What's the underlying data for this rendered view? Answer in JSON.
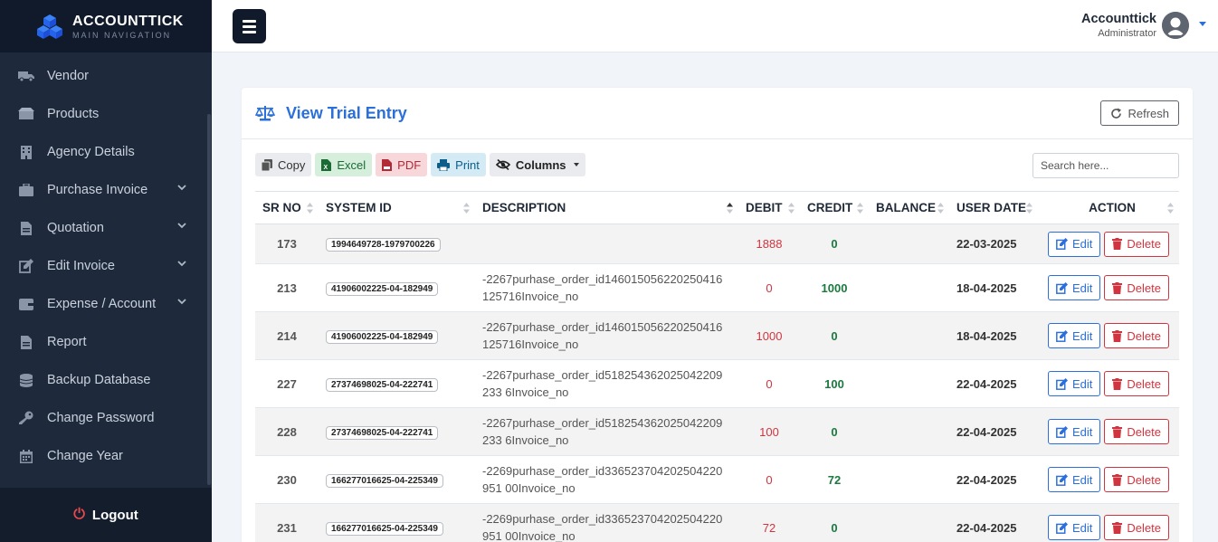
{
  "brand": {
    "title": "ACCOUNTTICK",
    "subtitle": "MAIN NAVIGATION"
  },
  "sidebar": {
    "items": [
      {
        "label": "Vendor",
        "icon": "truck-icon"
      },
      {
        "label": "Products",
        "icon": "box-icon"
      },
      {
        "label": "Agency Details",
        "icon": "building-icon"
      },
      {
        "label": "Purchase Invoice",
        "icon": "briefcase-icon",
        "expandable": true
      },
      {
        "label": "Quotation",
        "icon": "file-icon",
        "expandable": true
      },
      {
        "label": "Edit Invoice",
        "icon": "edit-icon",
        "expandable": true
      },
      {
        "label": "Expense / Account",
        "icon": "wallet-icon",
        "expandable": true
      },
      {
        "label": "Report",
        "icon": "file-icon"
      },
      {
        "label": "Backup Database",
        "icon": "database-icon"
      },
      {
        "label": "Change Password",
        "icon": "key-icon"
      },
      {
        "label": "Change Year",
        "icon": "calendar-icon"
      }
    ],
    "logout_label": "Logout"
  },
  "user": {
    "name": "Accounttick",
    "role": "Administrator"
  },
  "page": {
    "title": "View Trial Entry",
    "refresh_label": "Refresh",
    "toolbar": {
      "copy": "Copy",
      "excel": "Excel",
      "pdf": "PDF",
      "print": "Print",
      "columns": "Columns"
    },
    "search_placeholder": "Search here..."
  },
  "table": {
    "headers": [
      "SR NO",
      "SYSTEM ID",
      "DESCRIPTION",
      "DEBIT",
      "CREDIT",
      "BALANCE",
      "USER DATE",
      "ACTION"
    ],
    "edit_label": "Edit",
    "delete_label": "Delete",
    "rows": [
      {
        "sr": "173",
        "system_id": "1994649728-1979700226",
        "description": "",
        "debit": "1888",
        "credit": "0",
        "balance": "",
        "date": "22-03-2025"
      },
      {
        "sr": "213",
        "system_id": "41906002225-04-182949",
        "description": "-2267purhase_order_id146015056220250416125716Invoice_no",
        "debit": "0",
        "credit": "1000",
        "balance": "",
        "date": "18-04-2025"
      },
      {
        "sr": "214",
        "system_id": "41906002225-04-182949",
        "description": "-2267purhase_order_id146015056220250416125716Invoice_no",
        "debit": "1000",
        "credit": "0",
        "balance": "",
        "date": "18-04-2025"
      },
      {
        "sr": "227",
        "system_id": "27374698025-04-222741",
        "description": "-2267purhase_order_id518254362025042209233 6Invoice_no",
        "debit": "0",
        "credit": "100",
        "balance": "",
        "date": "22-04-2025"
      },
      {
        "sr": "228",
        "system_id": "27374698025-04-222741",
        "description": "-2267purhase_order_id518254362025042209233 6Invoice_no",
        "debit": "100",
        "credit": "0",
        "balance": "",
        "date": "22-04-2025"
      },
      {
        "sr": "230",
        "system_id": "166277016625-04-225349",
        "description": "-2269purhase_order_id336523704202504220951 00Invoice_no",
        "debit": "0",
        "credit": "72",
        "balance": "",
        "date": "22-04-2025"
      },
      {
        "sr": "231",
        "system_id": "166277016625-04-225349",
        "description": "-2269purhase_order_id336523704202504220951 00Invoice_no",
        "debit": "72",
        "credit": "0",
        "balance": "",
        "date": "22-04-2025"
      }
    ]
  },
  "colors": {
    "accent": "#2a6fdb",
    "sidebar_bg": "#1e2a3b",
    "debit": "#d0353f",
    "credit": "#1a7a3e"
  }
}
